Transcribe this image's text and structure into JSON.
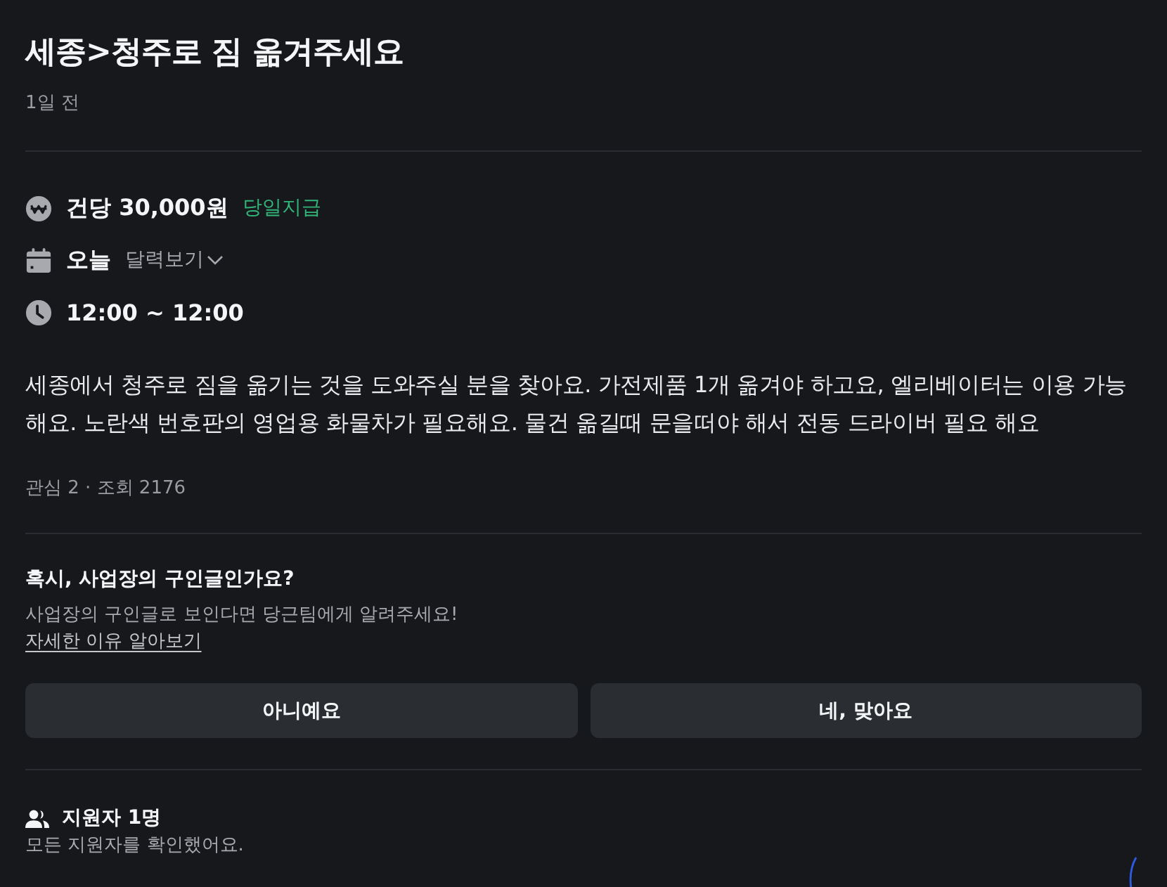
{
  "post": {
    "title": "세종>청주로 짐 옮겨주세요",
    "time": "1일 전"
  },
  "details": [
    {
      "kind": "pay",
      "text": "건당 30,000원",
      "tag": "당일지급"
    },
    {
      "kind": "date",
      "text": "오늘",
      "action": "달력보기"
    },
    {
      "kind": "time",
      "text": "12:00 ~ 12:00"
    }
  ],
  "description": "세종에서 청주로 짐을 옮기는 것을 도와주실 분을 찾아요. 가전제품 1개 옮겨야 하고요, 엘리베이터는 이용 가능해요. 노란색 번호판의 영업용 화물차가 필요해요. 물건 옮길때 문을떠야 해서 전동 드라이버 필요 해요",
  "stats": "관심 2 · 조회 2176",
  "report": {
    "title": "혹시, 사업장의 구인글인가요?",
    "text": "사업장의 구인글로 보인다면 당근팀에게 알려주세요!",
    "link": "자세한 이유 알아보기",
    "buttons": [
      "아니예요",
      "네, 맞아요"
    ]
  },
  "applicants": {
    "title": "지원자 1명",
    "text": "모든 지원자를 확인했어요."
  }
}
